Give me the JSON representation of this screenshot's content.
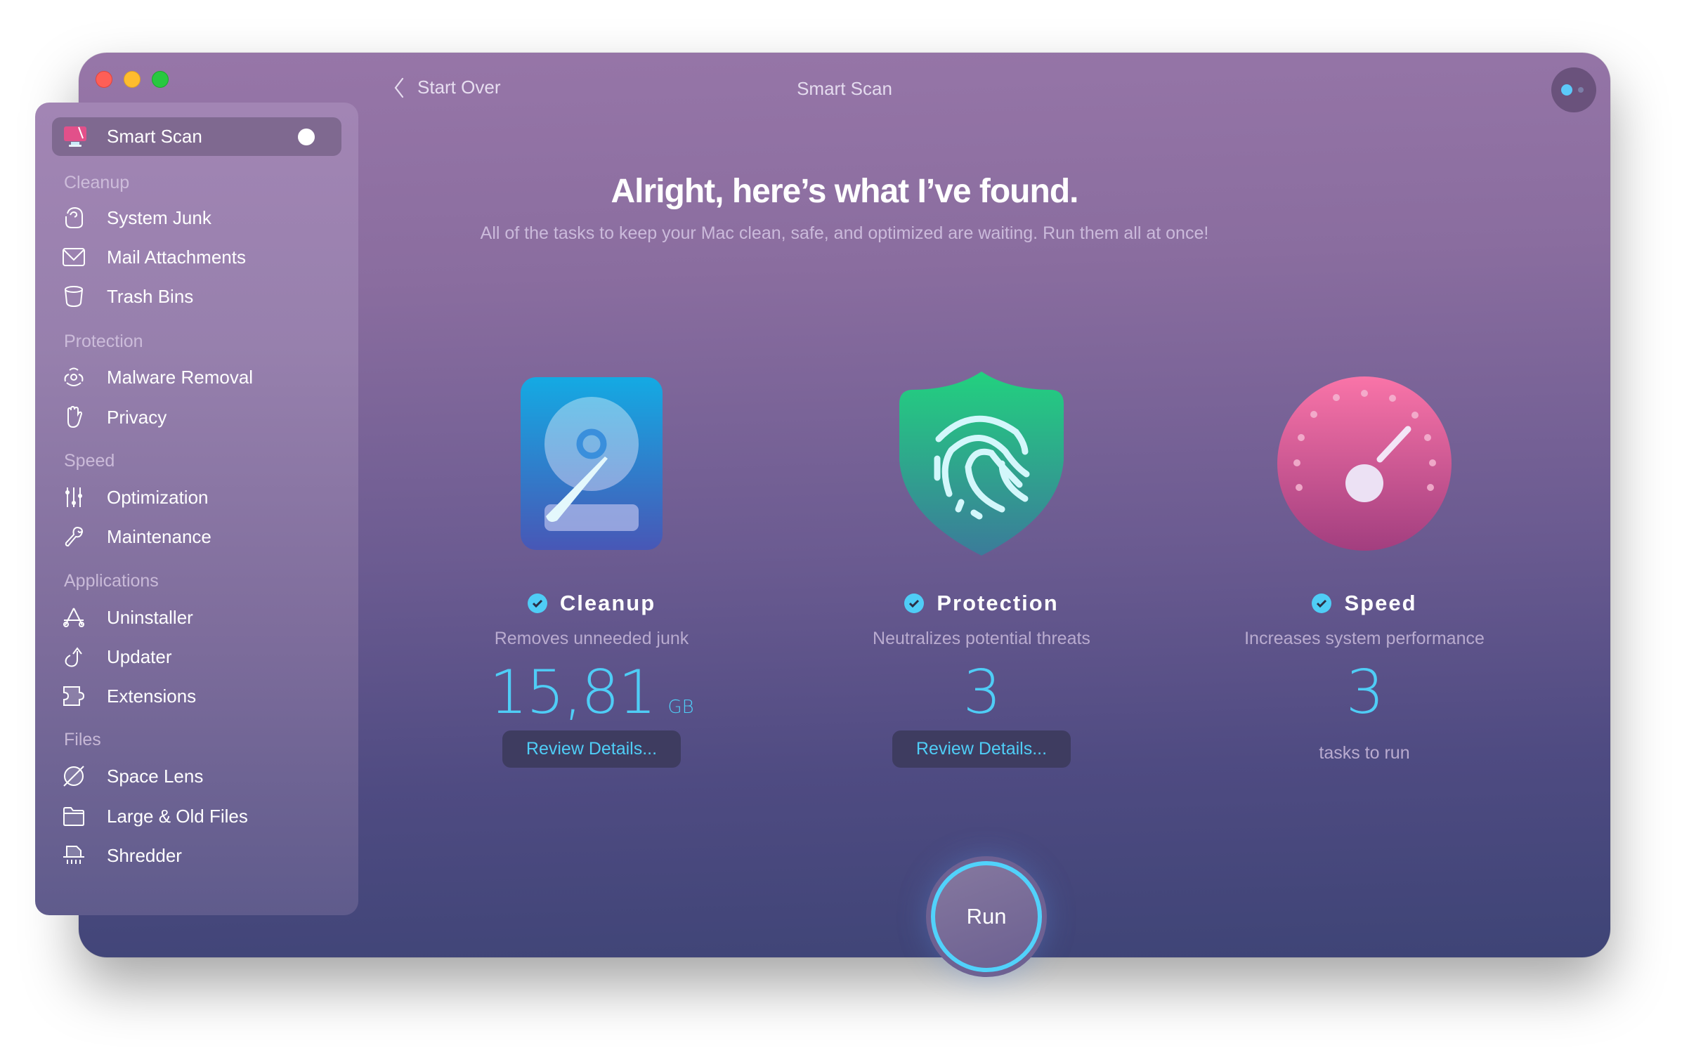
{
  "window": {
    "title": "Smart Scan",
    "back_label": "Start Over",
    "controls": [
      "close",
      "minimize",
      "zoom"
    ]
  },
  "sidebar": {
    "active_item": {
      "label": "Smart Scan",
      "icon": "smart-scan-monitor-icon"
    },
    "sections": [
      {
        "header": "Cleanup",
        "items": [
          {
            "label": "System Junk",
            "icon": "system-junk-icon"
          },
          {
            "label": "Mail Attachments",
            "icon": "mail-icon"
          },
          {
            "label": "Trash Bins",
            "icon": "trash-bin-icon"
          }
        ]
      },
      {
        "header": "Protection",
        "items": [
          {
            "label": "Malware Removal",
            "icon": "biohazard-icon"
          },
          {
            "label": "Privacy",
            "icon": "hand-icon"
          }
        ]
      },
      {
        "header": "Speed",
        "items": [
          {
            "label": "Optimization",
            "icon": "sliders-icon"
          },
          {
            "label": "Maintenance",
            "icon": "wrench-icon"
          }
        ]
      },
      {
        "header": "Applications",
        "items": [
          {
            "label": "Uninstaller",
            "icon": "app-store-icon"
          },
          {
            "label": "Updater",
            "icon": "update-arrow-icon"
          },
          {
            "label": "Extensions",
            "icon": "puzzle-icon"
          }
        ]
      },
      {
        "header": "Files",
        "items": [
          {
            "label": "Space Lens",
            "icon": "planet-icon"
          },
          {
            "label": "Large & Old Files",
            "icon": "folder-icon"
          },
          {
            "label": "Shredder",
            "icon": "shredder-icon"
          }
        ]
      }
    ]
  },
  "main": {
    "heading": "Alright, here’s what I’ve found.",
    "subheading": "All of the tasks to keep your Mac clean, safe, and optimized are waiting. Run them all at once!",
    "columns": [
      {
        "title": "Cleanup",
        "description": "Removes unneeded junk",
        "value": "15,81",
        "unit": "GB",
        "button": "Review Details...",
        "icon": "hard-drive-icon",
        "checked": true
      },
      {
        "title": "Protection",
        "description": "Neutralizes potential threats",
        "value": "3",
        "unit": "",
        "button": "Review Details...",
        "icon": "fingerprint-shield-icon",
        "checked": true
      },
      {
        "title": "Speed",
        "description": "Increases system performance",
        "value": "3",
        "unit": "",
        "caption": "tasks to run",
        "icon": "speedometer-icon",
        "checked": true
      }
    ],
    "run_label": "Run"
  },
  "colors": {
    "accent": "#4fcdf6",
    "window_top": "#9776a8",
    "window_bottom": "#3e4476",
    "sidebar_active": "#7f6990",
    "close": "#fe5f57",
    "minimize": "#febc2e",
    "zoom": "#28c840"
  }
}
